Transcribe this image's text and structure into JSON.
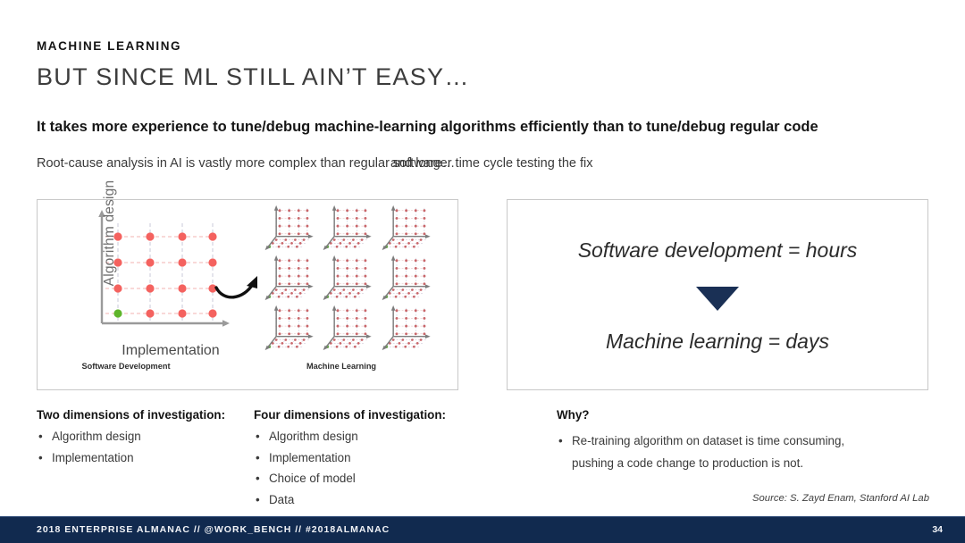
{
  "header": {
    "eyebrow": "MACHINE LEARNING",
    "title": "BUT SINCE ML STILL AIN’T EASY…",
    "lead": "It takes more experience to tune/debug machine-learning algorithms efficiently than to tune/debug regular code",
    "subline_left": "Root-cause analysis in AI is vastly more complex than regular software…",
    "subline_right": "and longer time cycle testing the fix"
  },
  "left_panel": {
    "y_axis_label": "Algorithm design",
    "x_axis_label": "Implementation",
    "caption_2d": "Software Development",
    "caption_3d": "Machine Learning",
    "grid_2d": {
      "cols": 4,
      "rows": 4,
      "dot_color": "#f4625f",
      "highlight_color": "#5fb52b",
      "highlight_index": [
        0,
        0
      ]
    },
    "grid_3d": {
      "plots": 9,
      "cols": 3,
      "rows": 3,
      "dot_color": "#c9666a",
      "highlight_color": "#6aa84f"
    }
  },
  "right_panel": {
    "line_top": "Software development = hours",
    "line_bottom": "Machine learning = days",
    "arrow_icon": "triangle-down-icon",
    "arrow_color": "#1a3055"
  },
  "columns": [
    {
      "heading": "Two dimensions of investigation:",
      "items": [
        "Algorithm design",
        "Implementation"
      ]
    },
    {
      "heading": "Four dimensions of investigation:",
      "items": [
        "Algorithm design",
        "Implementation",
        "Choice of model",
        "Data"
      ]
    },
    {
      "heading": "Why?",
      "items": [
        "Re-training algorithm on dataset is time consuming,"
      ],
      "continuation": "pushing a code change to production is not."
    }
  ],
  "source": "Source: S. Zayd Enam, Stanford AI Lab",
  "footer": {
    "text": "2018 ENTERPRISE ALMANAC  //  @WORK_BENCH  //  #2018ALMANAC",
    "page": "34",
    "background": "#112a4f"
  }
}
